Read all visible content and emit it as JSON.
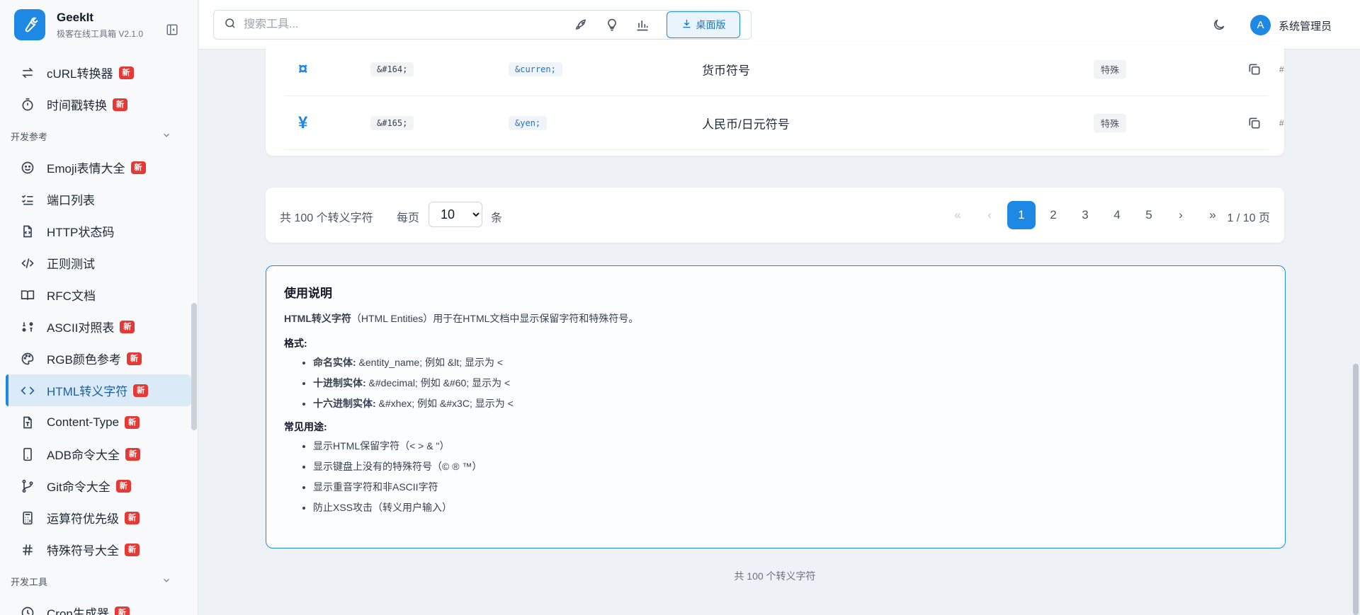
{
  "brand": {
    "name": "GeekIt",
    "subtitle": "极客在线工具箱",
    "version": "V2.1.0"
  },
  "sidebar": {
    "items_top": [
      {
        "label": "cURL转换器",
        "badge": "新",
        "icon": "arrows-swap-icon"
      },
      {
        "label": "时间戳转换",
        "badge": "新",
        "icon": "timer-icon"
      }
    ],
    "section_dev_ref": "开发参考",
    "items_ref": [
      {
        "label": "Emoji表情大全",
        "badge": "新",
        "icon": "smile-icon"
      },
      {
        "label": "端口列表",
        "badge": "",
        "icon": "list-check-icon"
      },
      {
        "label": "HTTP状态码",
        "badge": "",
        "icon": "file-code-icon"
      },
      {
        "label": "正则测试",
        "badge": "",
        "icon": "code-slash-icon"
      },
      {
        "label": "RFC文档",
        "badge": "",
        "icon": "book-icon"
      },
      {
        "label": "ASCII对照表",
        "badge": "新",
        "icon": "ascii-icon"
      },
      {
        "label": "RGB颜色参考",
        "badge": "新",
        "icon": "palette-icon"
      },
      {
        "label": "HTML转义字符",
        "badge": "新",
        "icon": "code-brackets-icon",
        "active": true
      },
      {
        "label": "Content-Type",
        "badge": "新",
        "icon": "file-type-icon"
      },
      {
        "label": "ADB命令大全",
        "badge": "新",
        "icon": "phone-icon"
      },
      {
        "label": "Git命令大全",
        "badge": "新",
        "icon": "git-branch-icon"
      },
      {
        "label": "运算符优先级",
        "badge": "新",
        "icon": "calculator-icon"
      },
      {
        "label": "特殊符号大全",
        "badge": "新",
        "icon": "hash-icon"
      }
    ],
    "section_dev_tools": "开发工具",
    "partial_item": {
      "label": "Cron生成器",
      "badge": "新"
    }
  },
  "topbar": {
    "search_placeholder": "搜索工具...",
    "desktop_label": "桌面版",
    "avatar_letter": "A",
    "user_name": "系统管理员"
  },
  "table": {
    "rows": [
      {
        "char": "¤",
        "decimal": "&#164;",
        "named": "&curren;",
        "desc": "货币符号",
        "category": "特殊",
        "link": "#"
      },
      {
        "char": "¥",
        "decimal": "&#165;",
        "named": "&yen;",
        "desc": "人民币/日元符号",
        "category": "特殊",
        "link": "#"
      }
    ]
  },
  "pager": {
    "total": "共 100 个转义字符",
    "per_page_label": "每页",
    "per_page_value": "10",
    "unit": "条",
    "pages": [
      "1",
      "2",
      "3",
      "4",
      "5"
    ],
    "current": "1",
    "page_info": "1 / 10 页"
  },
  "info": {
    "title": "使用说明",
    "intro_bold": "HTML转义字符",
    "intro_rest": "（HTML Entities）用于在HTML文档中显示保留字符和特殊符号。",
    "format_heading": "格式:",
    "formats": [
      {
        "bold": "命名实体:",
        "text": " &entity_name; 例如 &lt; 显示为 <"
      },
      {
        "bold": "十进制实体:",
        "text": " &#decimal; 例如 &#60; 显示为 <"
      },
      {
        "bold": "十六进制实体:",
        "text": " &#xhex; 例如 &#x3C; 显示为 <"
      }
    ],
    "usage_heading": "常见用途:",
    "usages": [
      "显示HTML保留字符（< > & \"）",
      "显示键盘上没有的特殊符号（© ® ™）",
      "显示重音字符和非ASCII字符",
      "防止XSS攻击（转义用户输入）"
    ]
  },
  "footer_total": "共 100 个转义字符"
}
